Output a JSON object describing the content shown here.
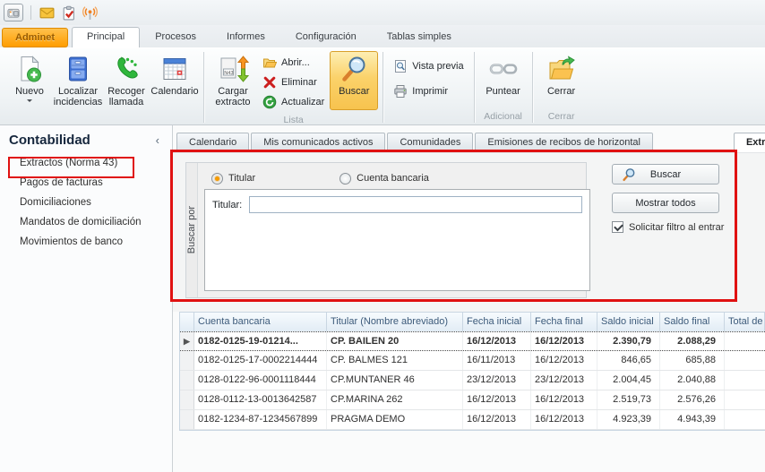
{
  "topbar": {
    "icons": [
      "app-window",
      "mail",
      "tasks",
      "broadcast"
    ]
  },
  "tabs": {
    "app_tab": "Adminet",
    "items": [
      "Principal",
      "Procesos",
      "Informes",
      "Configuración",
      "Tablas simples"
    ],
    "active": "Principal"
  },
  "ribbon": {
    "nuevo": "Nuevo",
    "localizar": "Localizar incidencias",
    "recoger": "Recoger llamada",
    "calendario": "Calendario",
    "cargar": "Cargar extracto",
    "n43_badge": "N43",
    "abrir": "Abrir...",
    "eliminar": "Eliminar",
    "actualizar": "Actualizar",
    "buscar": "Buscar",
    "vista_previa": "Vista previa",
    "imprimir": "Imprimir",
    "puntear": "Puntear",
    "cerrar": "Cerrar",
    "group_lista": "Lista",
    "group_adicional": "Adicional",
    "group_cerrar": "Cerrar"
  },
  "sidebar": {
    "title": "Contabilidad",
    "collapse_icon": "‹",
    "items": [
      "Extractos (Norma 43)",
      "Pagos de facturas",
      "Domiciliaciones",
      "Mandatos de domiciliación",
      "Movimientos de banco"
    ],
    "highlighted_item": "Extractos (Norma 43)"
  },
  "content": {
    "tabs": [
      "Calendario",
      "Mis comunicados activos",
      "Comunidades",
      "Emisiones de recibos de horizontal",
      "Extrac"
    ],
    "active_tab": "Extrac",
    "filter": {
      "panel_label": "Buscar por",
      "radio_titular": "Titular",
      "radio_cuenta": "Cuenta bancaria",
      "selected_radio": "Titular",
      "field_label": "Titular:",
      "field_value": "",
      "buscar_button": "Buscar",
      "mostrar_button": "Mostrar todos",
      "checkbox_label": "Solicitar filtro al entrar",
      "checkbox_checked": true
    },
    "table": {
      "selected_marker": "▶",
      "headers": [
        "Cuenta bancaria",
        "Titular (Nombre abreviado)",
        "Fecha inicial",
        "Fecha final",
        "Saldo inicial",
        "Saldo final",
        "Total de mov"
      ],
      "rows": [
        {
          "selected": true,
          "cells": [
            "0182-0125-19-01214...",
            "CP. BAILEN 20",
            "16/12/2013",
            "16/12/2013",
            "2.390,79",
            "2.088,29",
            ""
          ]
        },
        {
          "selected": false,
          "cells": [
            "0182-0125-17-0002214444",
            "CP. BALMES 121",
            "16/11/2013",
            "16/12/2013",
            "846,65",
            "685,88",
            ""
          ]
        },
        {
          "selected": false,
          "cells": [
            "0128-0122-96-0001118444",
            "CP.MUNTANER 46",
            "23/12/2013",
            "23/12/2013",
            "2.004,45",
            "2.040,88",
            ""
          ]
        },
        {
          "selected": false,
          "cells": [
            "0128-0112-13-0013642587",
            "CP.MARINA 262",
            "16/12/2013",
            "16/12/2013",
            "2.519,73",
            "2.576,26",
            ""
          ]
        },
        {
          "selected": false,
          "cells": [
            "0182-1234-87-1234567899",
            "PRAGMA DEMO",
            "16/12/2013",
            "16/12/2013",
            "4.923,39",
            "4.943,39",
            ""
          ]
        }
      ]
    }
  },
  "colors": {
    "accent_orange": "#ff9d00",
    "annotation_red": "#e01111",
    "ribbon_highlight": "#fbd26a"
  }
}
